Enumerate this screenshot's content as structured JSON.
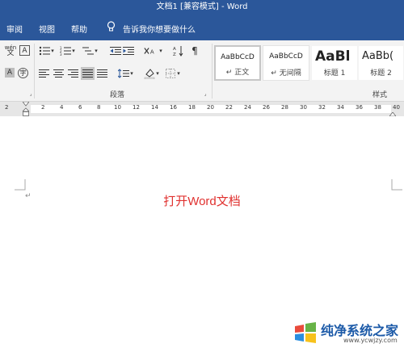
{
  "title": "文档1 [兼容模式] - Word",
  "menu": [
    "审阅",
    "视图",
    "帮助"
  ],
  "tell_me": "告诉我你想要做什么",
  "ribbon": {
    "paragraph_label": "段落",
    "styles_label": "样式",
    "wen_small": "wén",
    "wen_big": "文",
    "styles": [
      {
        "sample": "AaBbCcD",
        "name": "↵ 正文"
      },
      {
        "sample": "AaBbCcD",
        "name": "↵ 无间隔"
      },
      {
        "sample": "AaBl",
        "name": "标题 1"
      },
      {
        "sample": "AaBb(",
        "name": "标题 2"
      }
    ]
  },
  "ruler": {
    "ticks": [
      "2",
      "2",
      "4",
      "6",
      "8",
      "10",
      "12",
      "14",
      "16",
      "18",
      "20",
      "22",
      "24",
      "26",
      "28",
      "30",
      "32",
      "34",
      "36",
      "38",
      "40"
    ]
  },
  "document": {
    "text": "打开Word文档",
    "paragraph_mark": "↵"
  },
  "watermark": {
    "title": "纯净系统之家",
    "url": "www.ycwjzy.com"
  },
  "colors": {
    "accent": "#2b579a",
    "doc_text": "#e0312f"
  }
}
